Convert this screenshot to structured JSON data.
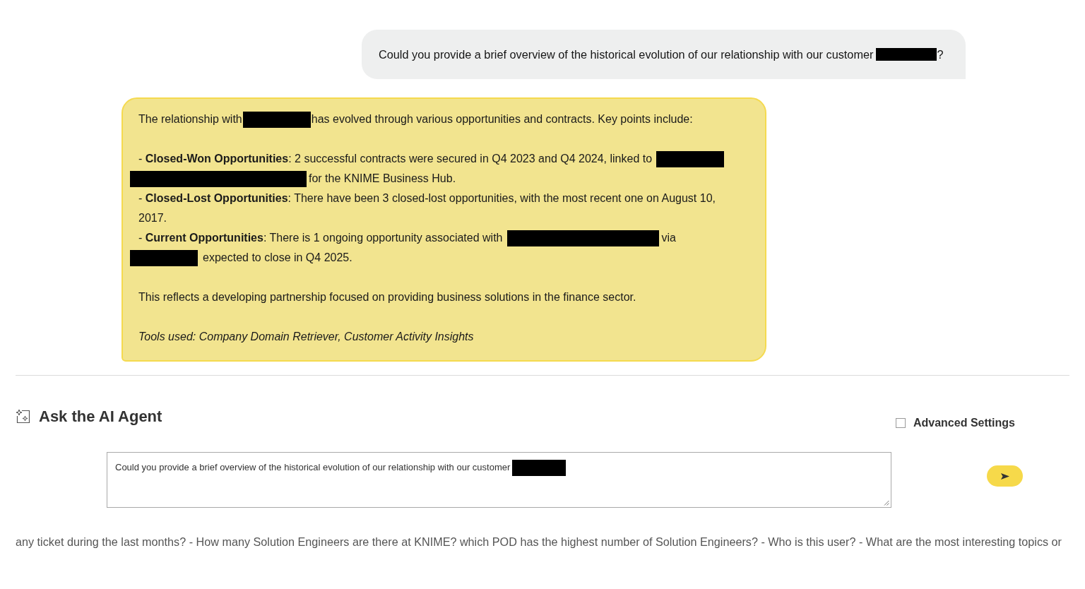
{
  "user_message": {
    "segments": [
      {
        "kind": "text",
        "text": "Could you provide a brief overview of the historical evolution of our relationship with our customer"
      },
      {
        "kind": "redacted"
      },
      {
        "kind": "text",
        "text": "?"
      }
    ]
  },
  "answer": {
    "paragraphs": [
      {
        "kind": "body",
        "lines": [
          [
            {
              "kind": "text",
              "text": "The relationship with"
            },
            {
              "kind": "redacted"
            },
            {
              "kind": "text",
              "text": "has evolved through various opportunities and contracts. Key points include:"
            }
          ]
        ]
      },
      {
        "kind": "body",
        "lines": [
          [
            {
              "kind": "text",
              "text": "- **Closed-Won Opportunities**: 2 successful contracts were secured in Q4 2023 and Q4 2024, linked to"
            },
            {
              "kind": "redacted"
            }
          ],
          [
            {
              "kind": "redacted"
            },
            {
              "kind": "text",
              "text": "for the KNIME Business Hub."
            }
          ],
          [
            {
              "kind": "text",
              "text": "- **Closed-Lost Opportunities**: There have been 3 closed-lost opportunities, with the most recent one on August 10, 2017."
            }
          ],
          [
            {
              "kind": "text",
              "text": "- **Current Opportunities**: There is 1 ongoing opportunity associated with"
            },
            {
              "kind": "redacted"
            },
            {
              "kind": "text",
              "text": "via"
            }
          ],
          [
            {
              "kind": "redacted"
            },
            {
              "kind": "text",
              "text": "expected to close in Q4 2025."
            }
          ]
        ]
      },
      {
        "kind": "body",
        "lines": [
          [
            {
              "kind": "text",
              "text": "This reflects a developing partnership focused on providing business solutions in the finance sector."
            }
          ]
        ]
      },
      {
        "kind": "tools",
        "lines": [
          [
            {
              "kind": "text",
              "text": "Tools used: Company Domain Retriever, Customer Activity Insights"
            }
          ]
        ]
      }
    ]
  },
  "ask_panel": {
    "title": "Ask the AI Agent",
    "advanced_settings": {
      "label": "Advanced Settings",
      "checked": false
    },
    "prompt": {
      "segments": [
        {
          "kind": "text",
          "text": "Could you provide a brief overview of the historical evolution of our relationship with our customer"
        },
        {
          "kind": "redacted"
        }
      ]
    }
  },
  "suggestions_ticker": "any ticket during the last months? - How many Solution Engineers are there at KNIME? which POD has the highest number of Solution Engineers? - Who is this user? - What are the most interesting topics or"
}
